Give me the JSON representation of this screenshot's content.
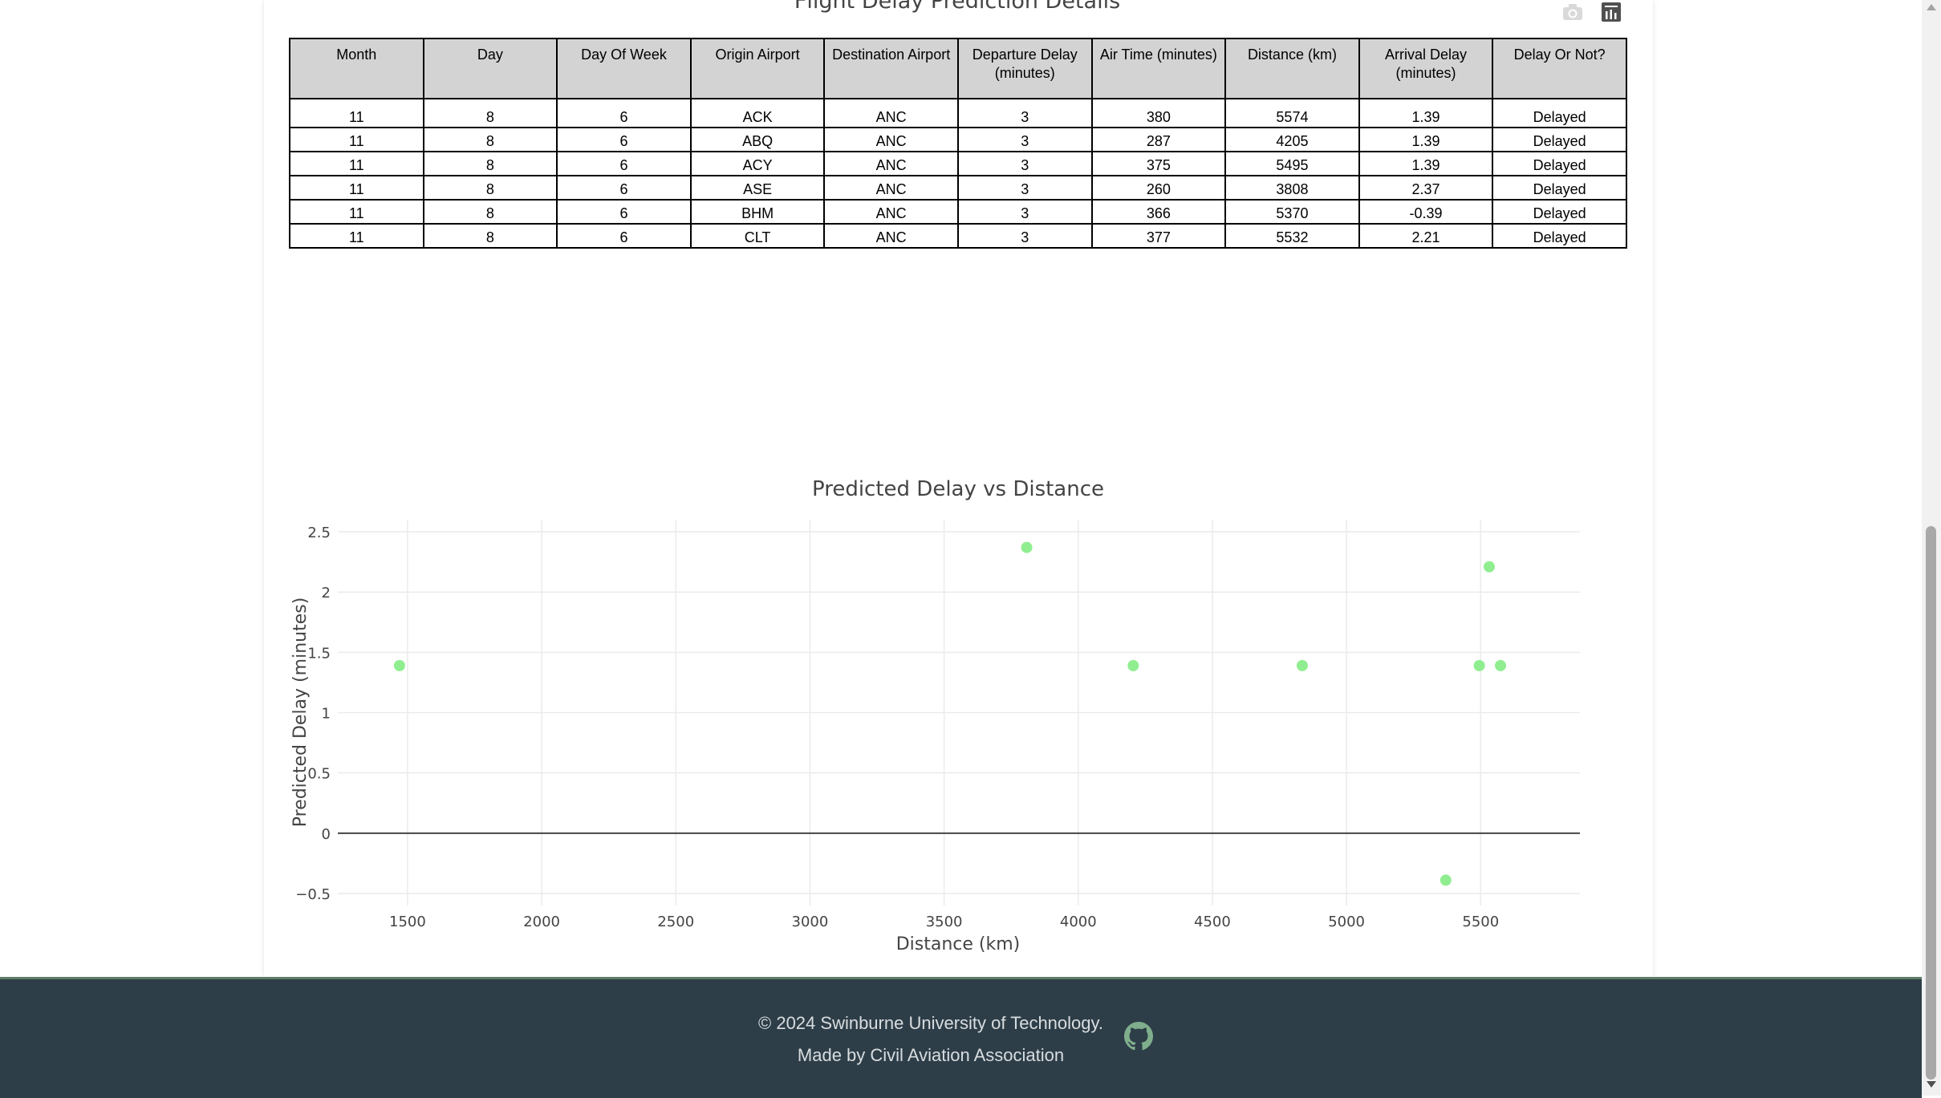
{
  "table_section": {
    "title": "Flight Delay Prediction Details",
    "columns": [
      "Month",
      "Day",
      "Day Of Week",
      "Origin Airport",
      "Destination Airport",
      "Departure Delay (minutes)",
      "Air Time (minutes)",
      "Distance (km)",
      "Arrival Delay (minutes)",
      "Delay Or Not?"
    ],
    "rows": [
      [
        "11",
        "8",
        "6",
        "ACK",
        "ANC",
        "3",
        "380",
        "5574",
        "1.39",
        "Delayed"
      ],
      [
        "11",
        "8",
        "6",
        "ABQ",
        "ANC",
        "3",
        "287",
        "4205",
        "1.39",
        "Delayed"
      ],
      [
        "11",
        "8",
        "6",
        "ACY",
        "ANC",
        "3",
        "375",
        "5495",
        "1.39",
        "Delayed"
      ],
      [
        "11",
        "8",
        "6",
        "ASE",
        "ANC",
        "3",
        "260",
        "3808",
        "2.37",
        "Delayed"
      ],
      [
        "11",
        "8",
        "6",
        "BHM",
        "ANC",
        "3",
        "366",
        "5370",
        "-0.39",
        "Delayed"
      ],
      [
        "11",
        "8",
        "6",
        "CLT",
        "ANC",
        "3",
        "377",
        "5532",
        "2.21",
        "Delayed"
      ]
    ]
  },
  "modebar": {
    "icons": [
      "camera-icon",
      "data-table-icon"
    ]
  },
  "chart_data": {
    "type": "scatter",
    "title": "Predicted Delay vs Distance",
    "xlabel": "Distance (km)",
    "ylabel": "Predicted Delay (minutes)",
    "x": [
      1470,
      3808,
      4205,
      4835,
      5370,
      5495,
      5532,
      5574
    ],
    "y": [
      1.39,
      2.37,
      1.39,
      1.39,
      -0.39,
      1.39,
      2.21,
      1.39
    ],
    "xlim": [
      1240,
      5870
    ],
    "ylim": [
      -0.6,
      2.6
    ],
    "xticks": [
      1500,
      2000,
      2500,
      3000,
      3500,
      4000,
      4500,
      5000,
      5500
    ],
    "xtick_labels": [
      "1500",
      "2000",
      "2500",
      "3000",
      "3500",
      "4000",
      "4500",
      "5000",
      "5500"
    ],
    "yticks": [
      -0.5,
      0,
      0.5,
      1,
      1.5,
      2,
      2.5
    ],
    "ytick_labels": [
      "−0.5",
      "0",
      "0.5",
      "1",
      "1.5",
      "2",
      "2.5"
    ],
    "marker_color": "#90ee90",
    "grid": true
  },
  "footer": {
    "copyright": "© 2024 Swinburne University of Technology.",
    "made_by": "Made by Civil Aviation Association",
    "icon": "github-icon",
    "background": "#2e3e48"
  }
}
